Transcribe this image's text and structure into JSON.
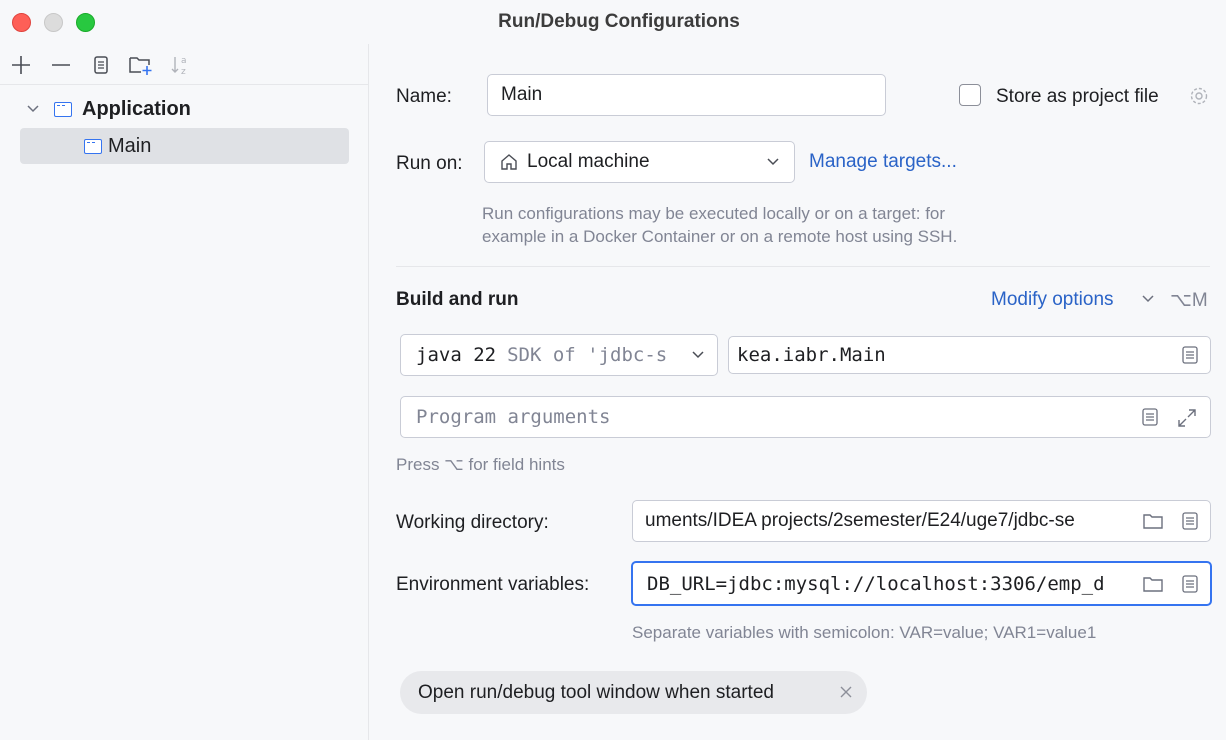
{
  "window": {
    "title": "Run/Debug Configurations"
  },
  "tree": {
    "group_label": "Application",
    "item_label": "Main"
  },
  "form": {
    "name_label": "Name:",
    "name_value": "Main",
    "store_label": "Store as project file",
    "run_on_label": "Run on:",
    "run_on_value": "Local machine",
    "manage_targets": "Manage targets...",
    "run_on_hint_1": "Run configurations may be executed locally or on a target: for",
    "run_on_hint_2": "example in a Docker Container or on a remote host using SSH.",
    "build_run_title": "Build and run",
    "modify_options": "Modify options",
    "modify_shortcut": "⌥M",
    "sdk_value": "java 22",
    "sdk_detail": "SDK of 'jdbc-s",
    "main_class": "kea.iabr.Main",
    "program_args_placeholder": "Program arguments",
    "field_hints": "Press ⌥ for field hints",
    "workdir_label": "Working directory:",
    "workdir_value": "uments/IDEA projects/2semester/E24/uge7/jdbc-se",
    "env_label": "Environment variables:",
    "env_value": "DB_URL=jdbc:mysql://localhost:3306/emp_d",
    "env_hint": "Separate variables with semicolon: VAR=value; VAR1=value1",
    "chip_label": "Open run/debug tool window when started"
  },
  "colors": {
    "accent": "#3574f0",
    "link": "#2a63c7",
    "hint": "#818594"
  }
}
